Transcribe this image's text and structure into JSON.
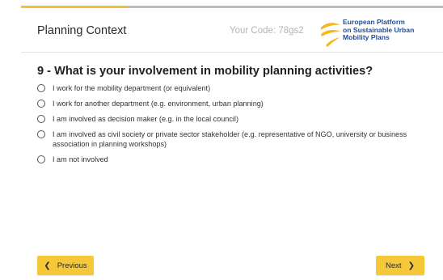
{
  "progress": {
    "fraction": 0.25,
    "fill_color": "#f2c12e",
    "track_color": "#b7bcc3"
  },
  "header": {
    "section_title": "Planning Context",
    "code_label": "Your Code: 78gs2",
    "logo": {
      "icon": "eltis-swoosh-logo",
      "line1": "European Platform",
      "line2": "on Sustainable Urban",
      "line3": "Mobility Plans",
      "color": "#1f4e9c"
    }
  },
  "question": {
    "text": "9 - What is your involvement in mobility planning activities?",
    "options": [
      {
        "label": "I work for the mobility department (or equivalent)",
        "selected": false
      },
      {
        "label": "I work for another department (e.g. environment, urban planning)",
        "selected": false
      },
      {
        "label": "I am involved as decision maker (e.g. in the local council)",
        "selected": false
      },
      {
        "label": "I am involved as civil society or private sector stakeholder (e.g. representative of NGO, university or business association in planning workshops)",
        "selected": false
      },
      {
        "label": "I am not involved",
        "selected": false
      }
    ]
  },
  "navigation": {
    "previous_label": "Previous",
    "previous_icon": "chevron-left-icon",
    "next_label": "Next",
    "next_icon": "chevron-right-icon",
    "button_color": "#f5c838"
  }
}
